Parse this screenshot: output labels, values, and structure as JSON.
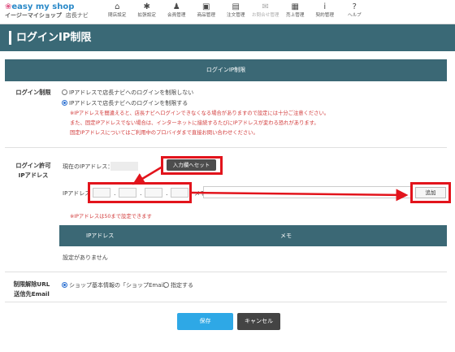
{
  "header": {
    "logo_text": "easy my shop",
    "logo_sub": "イージーマイショップ",
    "logo_sub2": "店長ナビ",
    "nav": [
      {
        "label": "閉店設定",
        "icon": "home-icon",
        "glyph": "⌂"
      },
      {
        "label": "拡張設定",
        "icon": "gear-icon",
        "glyph": "✱"
      },
      {
        "label": "会員管理",
        "icon": "user-icon",
        "glyph": "♟"
      },
      {
        "label": "商品管理",
        "icon": "gift-icon",
        "glyph": "▣"
      },
      {
        "label": "注文管理",
        "icon": "document-icon",
        "glyph": "▤"
      },
      {
        "label": "お問合せ管理",
        "icon": "mail-icon",
        "glyph": "✉"
      },
      {
        "label": "売上管理",
        "icon": "calculator-icon",
        "glyph": "▦"
      },
      {
        "label": "契約管理",
        "icon": "info-icon",
        "glyph": "i"
      },
      {
        "label": "ヘルプ",
        "icon": "help-icon",
        "glyph": "?"
      }
    ]
  },
  "page": {
    "title": "ログインIP制限"
  },
  "section": {
    "heading": "ログインIP制限"
  },
  "login_limit": {
    "label": "ログイン制限",
    "option_off": "IPアドレスで店長ナビへのログインを制限しない",
    "option_on": "IPアドレスで店長ナビへのログインを制限する",
    "selected": "on",
    "notes": [
      "※IPアドレスを間違えると、店長ナビへログインできなくなる場合がありますので設定には十分ご注意ください。",
      "また、固定IPアドレスでない場合は、インターネットに接続するたびにIPアドレスが変わる恐れがあります。",
      "固定IPアドレスについてはご利用中のプロバイダまで直接お問い合わせください。"
    ]
  },
  "allow_ip": {
    "label_line1": "ログイン許可",
    "label_line2": "IPアドレス",
    "current_ip_label": "現在のIPアドレス：",
    "set_button": "入力欄へセット",
    "ip_input_label": "IPアドレス",
    "memo_label": "メモ",
    "add_button": "追加",
    "limit_note": "※IPアドレスは50まで設定できます",
    "table_headers": [
      "IPアドレス",
      "メモ"
    ],
    "empty_message": "設定がありません"
  },
  "unlock_email": {
    "label_line1": "制限解除URL",
    "label_line2": "送信先Email",
    "option_shop": "ショップ基本情報の「ショップEmail」",
    "option_custom": "指定する",
    "selected": "shop"
  },
  "footer": {
    "save": "保存",
    "cancel": "キャンセル"
  },
  "colors": {
    "header_teal": "#3a6976",
    "save_blue": "#2ea8e6",
    "highlight_red": "#e2141c",
    "note_red": "#d23b3b"
  }
}
